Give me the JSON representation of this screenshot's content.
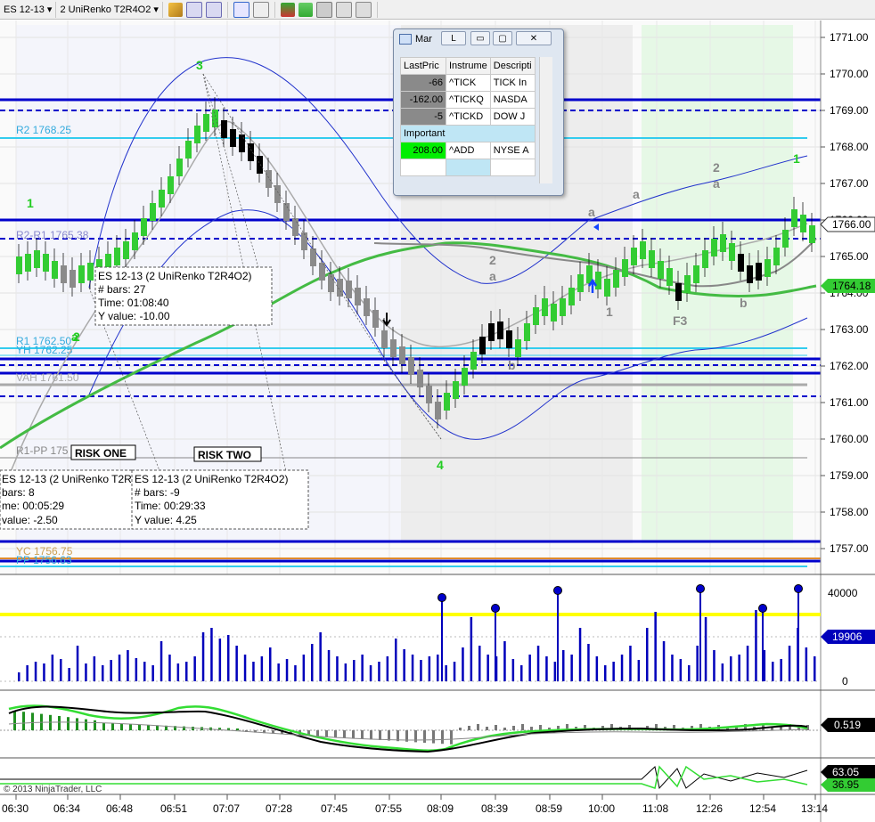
{
  "toolbar": {
    "instrument": "ES 12-13",
    "period": "2 UniRenko T2R4O2",
    "icons": [
      "pencil-icon",
      "zoom-in-icon",
      "zoom-out-icon",
      "crosshair-icon",
      "properties-icon",
      "chart-style-icon",
      "chart-type-icon",
      "strategy-icon",
      "dollar-icon",
      "data-box-icon"
    ]
  },
  "price_axis": {
    "ticks": [
      "1771.00",
      "1770.00",
      "1769.00",
      "1768.00",
      "1767.00",
      "1766.00",
      "1765.00",
      "1764.00",
      "1763.00",
      "1762.00",
      "1761.00",
      "1760.00",
      "1759.00",
      "1758.00",
      "1757.00"
    ],
    "last_price": "1766.00",
    "ma_price": "1764.18"
  },
  "time_axis": [
    "06:30",
    "06:34",
    "06:48",
    "06:51",
    "07:07",
    "07:28",
    "07:45",
    "07:55",
    "08:09",
    "08:39",
    "08:59",
    "10:00",
    "11:08",
    "12:26",
    "12:54",
    "13:14"
  ],
  "levels": {
    "r2": "R2 1768.25",
    "r2r1": "R2-R1 1765.38",
    "r1": "R1 1762.50",
    "yh": "YH 1762.25",
    "vah": "VAH 1761.50",
    "r1pp": "R1-PP 175",
    "yc": "YC 1756.75",
    "pp": "PP 1756.63"
  },
  "swing_labels": [
    "3",
    "1",
    "2",
    "4",
    "a",
    "2",
    "a",
    "b",
    "a",
    "a",
    "2",
    "a",
    "1",
    "F3",
    "b",
    "1",
    "1"
  ],
  "risk_labels": {
    "one": "RISK ONE",
    "two": "RISK TWO"
  },
  "tooltips": {
    "t1": {
      "title": "ES 12-13 (2 UniRenko T2R4O2)",
      "bars": "# bars:  27",
      "time": "Time:    01:08:40",
      "yvalue": "Y value: -10.00"
    },
    "t2": {
      "title": "ES 12-13 (2 UniRenko T2R",
      "bars": "bars:   8",
      "time": "me:     00:05:29",
      "yvalue": "value: -2.50"
    },
    "t3": {
      "title": "ES 12-13 (2 UniRenko T2R4O2)",
      "bars": "# bars:  -9",
      "time": "Time:    00:29:33",
      "yvalue": "Y value: 4.25"
    }
  },
  "volume_panel": {
    "ticks": [
      "40000",
      "20000",
      "0"
    ],
    "current": "19906"
  },
  "osc_panel": {
    "current": "0.519"
  },
  "bottom_panel": {
    "value1": "63.05",
    "value2": "36.95"
  },
  "copyright": "© 2013 NinjaTrader, LLC",
  "market_analyzer": {
    "title": "Mar",
    "linked_button": "L",
    "headers": [
      "LastPric",
      "Instrume",
      "Descripti"
    ],
    "rows": [
      {
        "last": "-66",
        "instrument": "^TICK",
        "description": "TICK In"
      },
      {
        "last": "-162.00",
        "instrument": "^TICKQ",
        "description": "NASDA"
      },
      {
        "last": "-5",
        "instrument": "^TICKD",
        "description": "DOW J"
      }
    ],
    "group_label": "Important",
    "important_row": {
      "last": "208.00",
      "instrument": "^ADD",
      "description": "NYSE A"
    }
  },
  "colors": {
    "up_bar": "#33cc33",
    "down_bar_light": "#8a8a8a",
    "down_bar_dark": "#000000",
    "pivot_blue": "#0000cc",
    "r_level": "#33ccee",
    "ema_green": "#33bb33",
    "band_blue": "#2233cc",
    "highlight_green": "#00ff00",
    "volume_threshold": "#ffff00"
  }
}
